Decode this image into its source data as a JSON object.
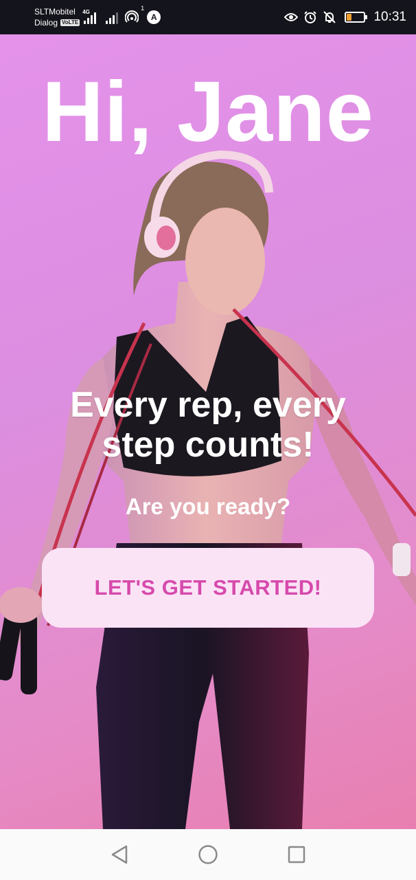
{
  "status_bar": {
    "carrier_1": "SLTMobitel",
    "carrier_2": "Dialog",
    "volte_badge": "VoLTE",
    "network_type": "4G",
    "hotspot_count": "1",
    "app_icon_letter": "A",
    "time": "10:31",
    "battery_level": 0.25,
    "battery_color": "#f0a030",
    "icons": [
      "eye-comfort-icon",
      "alarm-icon",
      "notifications-off-icon",
      "battery-icon"
    ]
  },
  "hero": {
    "greeting": "Hi, Jane",
    "tagline": "Every rep, every step counts!",
    "subtitle": "Are you ready?",
    "cta_label": "LET'S GET STARTED!",
    "background_color": "#e492ea",
    "cta_background": "#fbe3f6",
    "cta_text_color": "#d64aac"
  },
  "nav_bar": {
    "buttons": [
      "back-icon",
      "home-icon",
      "recents-icon"
    ]
  }
}
